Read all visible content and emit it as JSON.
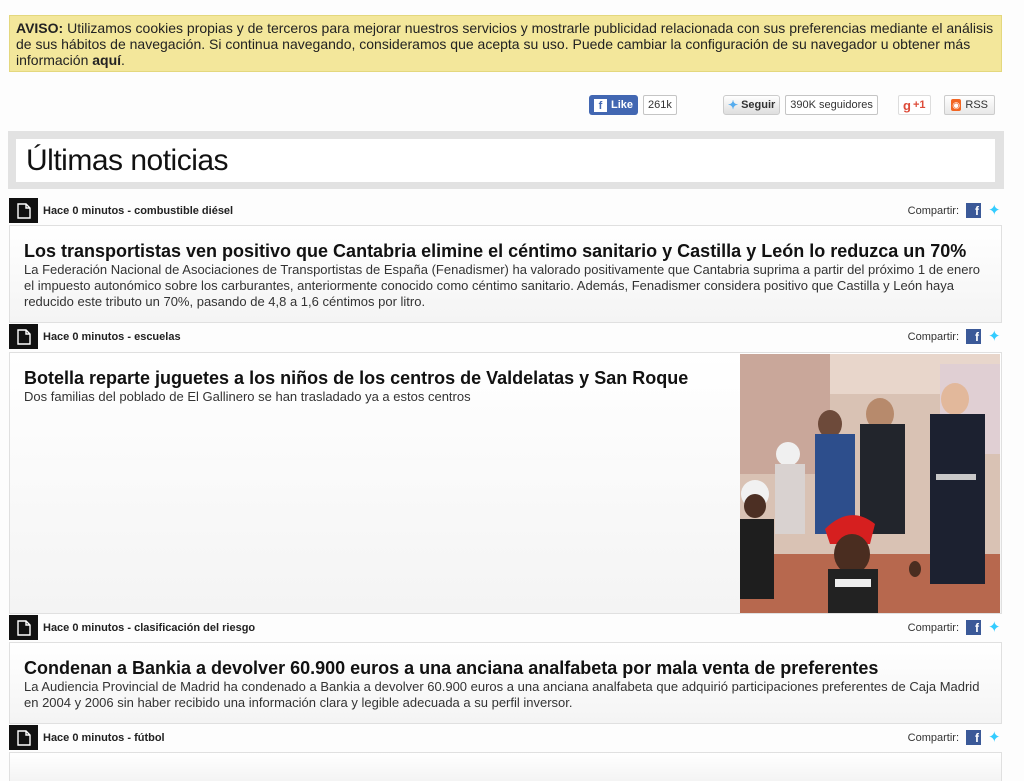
{
  "cookie": {
    "label": "AVISO:",
    "text": "Utilizamos cookies propias y de terceros para mejorar nuestros servicios y mostrarle publicidad relacionada con sus preferencias mediante el análisis de sus hábitos de navegación. Si continua navegando, consideramos que acepta su uso. Puede cambiar la configuración de su navegador u obtener más información",
    "link": "aquí",
    "period": "."
  },
  "social": {
    "like_label": "Like",
    "like_count": "261k",
    "follow_label": "Seguir",
    "follow_count": "390K seguidores",
    "gplus_label": "+1",
    "rss_label": "RSS"
  },
  "section": {
    "title": "Últimas noticias"
  },
  "share_label": "Compartir:",
  "articles": [
    {
      "meta": "Hace 0 minutos - combustible diésel",
      "title": "Los transportistas ven positivo que Cantabria elimine el céntimo sanitario y Castilla y León lo reduzca un 70%",
      "summary": "La Federación Nacional de Asociaciones de Transportistas de España (Fenadismer) ha valorado positivamente que Cantabria suprima a partir del próximo 1 de enero el impuesto autonómico sobre los carburantes, anteriormente conocido como céntimo sanitario. Además, Fenadismer considera positivo que Castilla y León haya reducido este tributo un 70%, pasando de 4,8 a 1,6 céntimos por litro."
    },
    {
      "meta": "Hace 0 minutos - escuelas",
      "title": "Botella reparte juguetes a los niños de los centros de Valdelatas y San Roque",
      "summary": "Dos familias del poblado de El Gallinero se han trasladado ya a estos centros"
    },
    {
      "meta": "Hace 0 minutos - clasificación del riesgo",
      "title": "Condenan a Bankia a devolver 60.900 euros a una anciana analfabeta por mala venta de preferentes",
      "summary": "La Audiencia Provincial de Madrid ha condenado a Bankia a devolver 60.900 euros a una anciana analfabeta que adquirió participaciones preferentes de Caja Madrid en 2004 y 2006 sin haber recibido una información clara y legible adecuada a su perfil inversor."
    },
    {
      "meta": "Hace 0 minutos - fútbol"
    }
  ]
}
